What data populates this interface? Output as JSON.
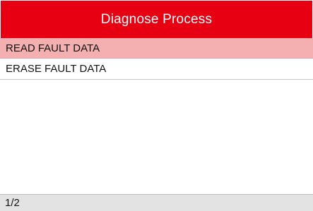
{
  "header": {
    "title": "Diagnose Process"
  },
  "menu": {
    "items": [
      {
        "label": "READ FAULT DATA",
        "selected": true
      },
      {
        "label": "ERASE FAULT DATA",
        "selected": false
      }
    ]
  },
  "status": {
    "page_indicator": "1/2"
  },
  "colors": {
    "title_bar": "#e60012",
    "selected_row": "#f4b0b1",
    "status_bar": "#e3e3e3"
  }
}
